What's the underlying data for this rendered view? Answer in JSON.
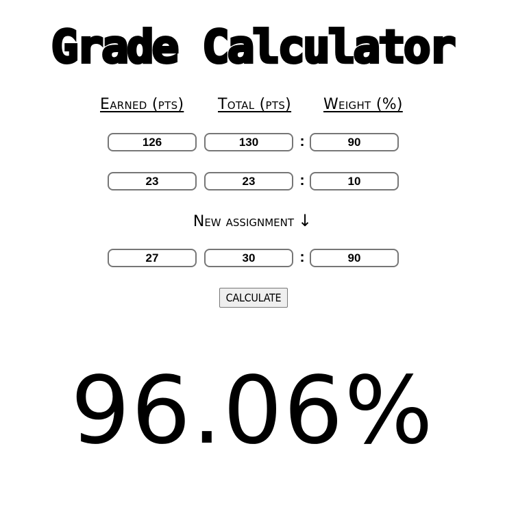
{
  "app": {
    "title": "Grade Calculator"
  },
  "headers": {
    "earned": "Earned (pts)",
    "total": "Total (pts)",
    "weight": "Weight (%)"
  },
  "rows": [
    {
      "earned": "126",
      "total": "130",
      "separator": ":",
      "weight": "90"
    },
    {
      "earned": "23",
      "total": "23",
      "separator": ":",
      "weight": "10"
    }
  ],
  "new_assignment": {
    "label": "New assignment",
    "arrow": "↓",
    "earned": "27",
    "total": "30",
    "separator": ":",
    "weight": "90"
  },
  "calculate_button": {
    "label": "CALCULATE"
  },
  "result": {
    "value": "96.06%"
  }
}
